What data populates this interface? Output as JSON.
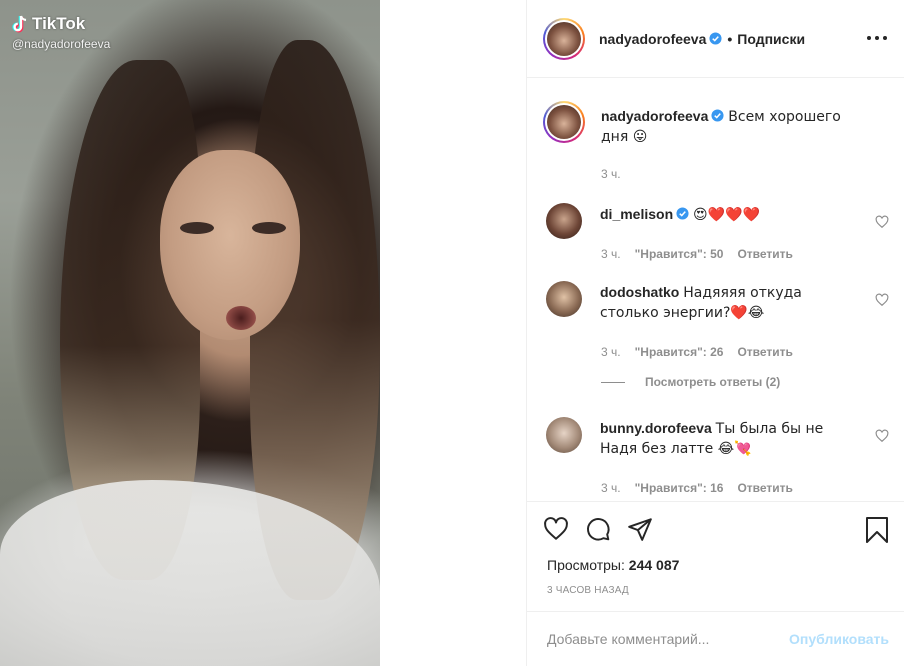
{
  "media": {
    "watermark_brand": "TikTok",
    "watermark_handle": "@nadyadorofeeva"
  },
  "header": {
    "username": "nadyadorofeeva",
    "separator": "•",
    "follow_label": "Подписки"
  },
  "caption": {
    "username": "nadyadorofeeva",
    "text": "Всем хорошего дня 😛",
    "time": "3 ч."
  },
  "comments": [
    {
      "username": "di_melison",
      "verified": true,
      "text": "😍❤️❤️❤️",
      "time": "3 ч.",
      "likes": "\"Нравится\": 50",
      "reply": "Ответить"
    },
    {
      "username": "dodoshatko",
      "verified": false,
      "text": "Надяяяя откуда столько энергии?❤️😂",
      "time": "3 ч.",
      "likes": "\"Нравится\": 26",
      "reply": "Ответить"
    },
    {
      "username": "bunny.dorofeeva",
      "verified": false,
      "text": "Ты была бы не Надя без латте 😂💘",
      "time": "3 ч.",
      "likes": "\"Нравится\": 16",
      "reply": "Ответить"
    }
  ],
  "view_replies": "Посмотреть ответы (2)",
  "actions": {
    "icons": [
      "heart-icon",
      "comment-icon",
      "share-icon",
      "bookmark-icon"
    ],
    "views_label": "Просмотры: ",
    "views_count": "244 087",
    "time_ago": "3 ЧАСОВ НАЗАД"
  },
  "add_comment": {
    "placeholder": "Добавьте комментарий...",
    "publish_label": "Опубликовать"
  },
  "colors": {
    "verified": "#3897f0",
    "publish_disabled": "#b2dffc",
    "secondary_text": "#8e8e8e"
  }
}
